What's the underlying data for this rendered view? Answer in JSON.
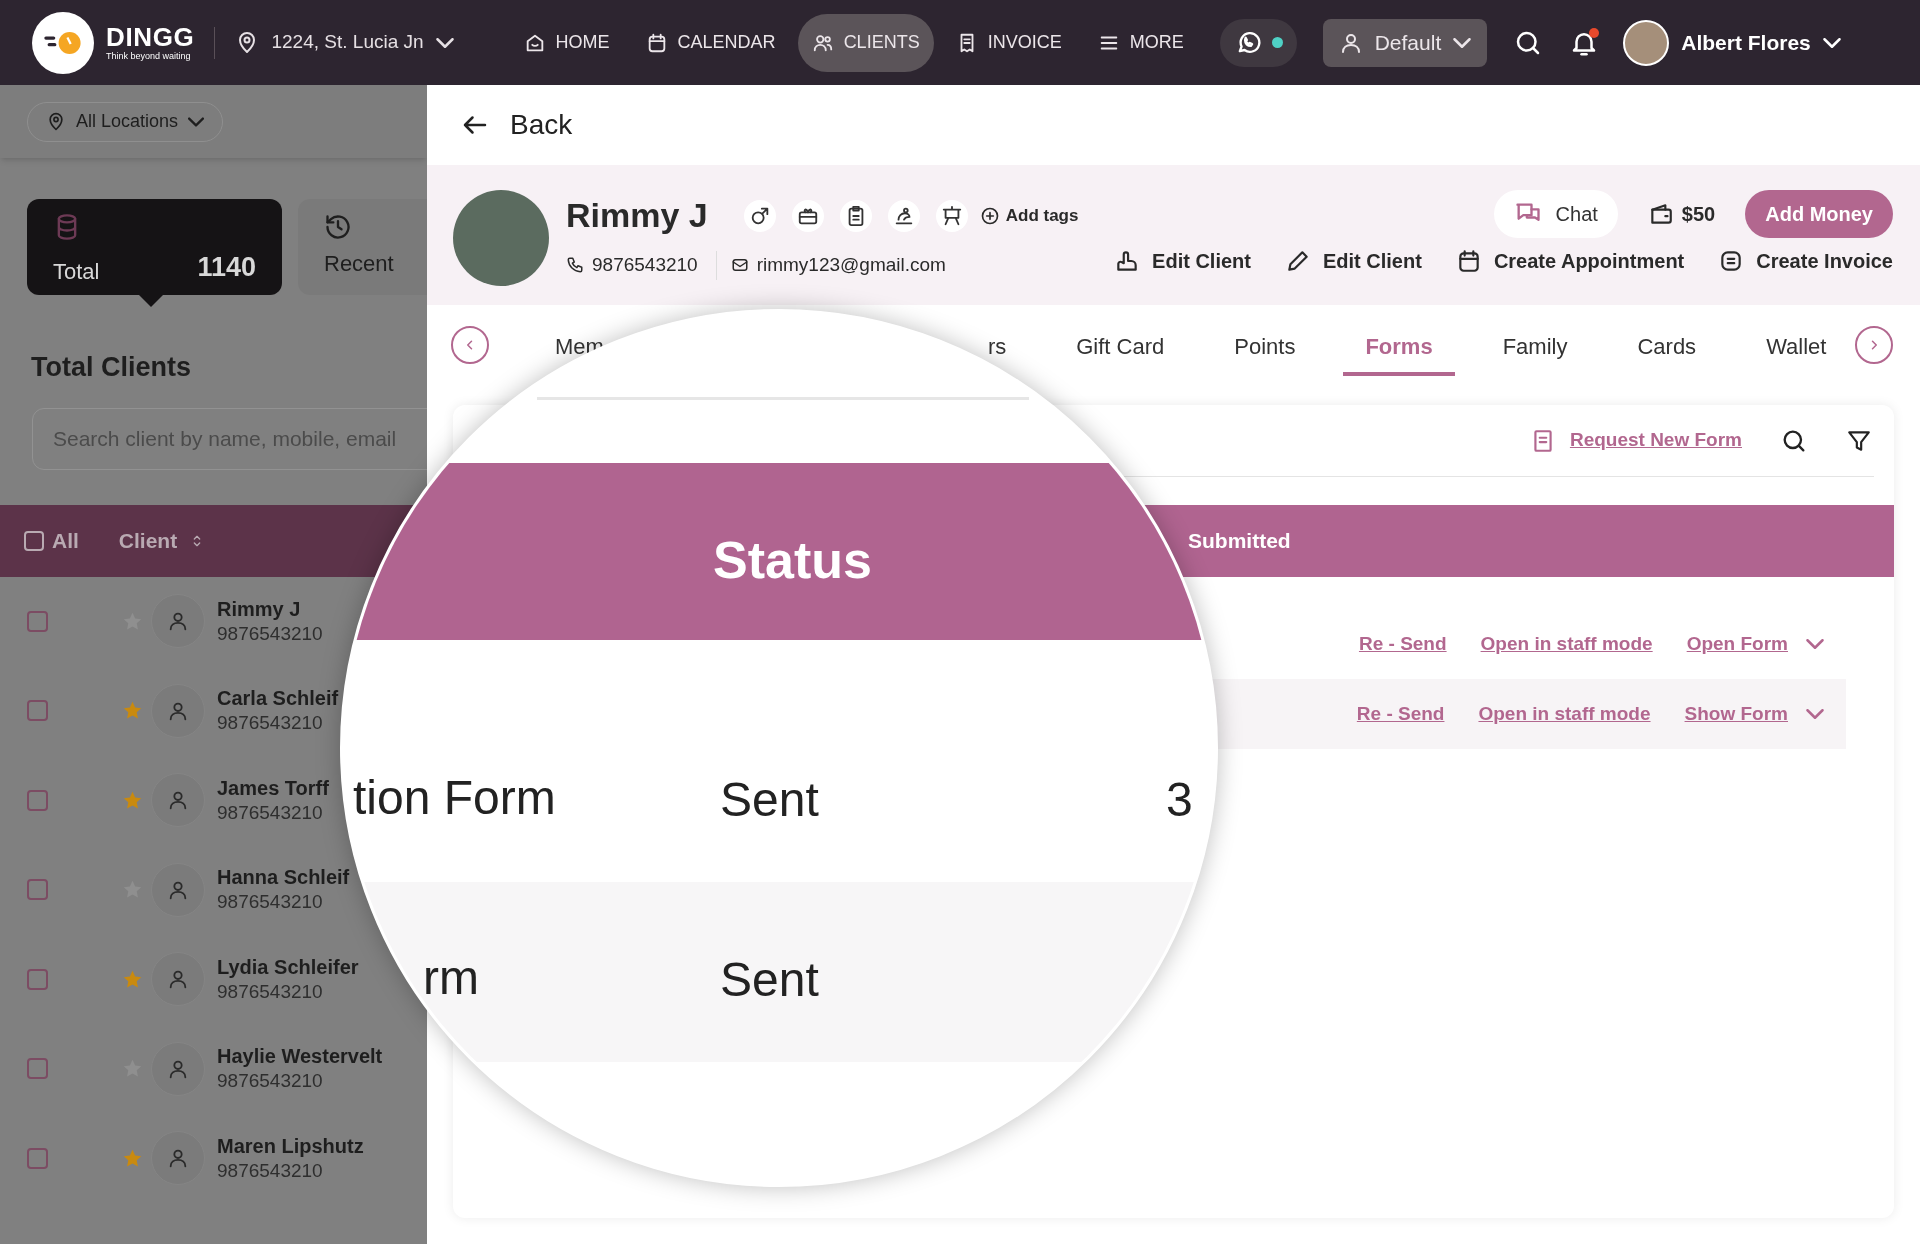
{
  "top_bar": {
    "logo": {
      "name": "DINGG",
      "tagline": "Think beyond waiting"
    },
    "location": "1224, St. Lucia Jn",
    "nav": [
      {
        "label": "HOME",
        "selected": false
      },
      {
        "label": "CALENDAR",
        "selected": false
      },
      {
        "label": "CLIENTS",
        "selected": true
      },
      {
        "label": "INVOICE",
        "selected": false
      },
      {
        "label": "MORE",
        "selected": false
      }
    ],
    "whatsapp": {
      "online": true
    },
    "profile": "Default",
    "notifications": {
      "unread": true
    },
    "user": "Albert Flores"
  },
  "left_panel": {
    "location_filter": "All Locations",
    "stats": [
      {
        "label": "Total",
        "count": "1140",
        "selected": true
      },
      {
        "label": "Recent",
        "selected": false
      }
    ],
    "title": "Total Clients",
    "search": {
      "placeholder": "Search client by name, mobile, email"
    },
    "table_header": {
      "all": "All",
      "all_checked": false,
      "client": "Client"
    },
    "rows": [
      {
        "name": "Rimmy J",
        "phone": "9876543210",
        "starred": false,
        "checked": false
      },
      {
        "name": "Carla Schleif",
        "phone": "9876543210",
        "starred": true,
        "checked": false
      },
      {
        "name": "James Torff",
        "phone": "9876543210",
        "starred": true,
        "checked": false
      },
      {
        "name": "Hanna Schleif",
        "phone": "9876543210",
        "starred": false,
        "checked": false
      },
      {
        "name": "Lydia Schleifer",
        "phone": "9876543210",
        "starred": true,
        "checked": false
      },
      {
        "name": "Haylie Westervelt",
        "phone": "9876543210",
        "starred": false,
        "checked": false
      },
      {
        "name": "Maren Lipshutz",
        "phone": "9876543210",
        "starred": true,
        "checked": false
      }
    ]
  },
  "client_detail": {
    "back": "Back",
    "name": "Rimmy J",
    "phone": "9876543210",
    "email": "rimmy123@gmail.com",
    "add_tags": "Add tags",
    "chat": "Chat",
    "wallet": "$50",
    "add_money": "Add Money",
    "actions": [
      "Edit Client",
      "Edit Client",
      "Create Appointment",
      "Create Invoice"
    ],
    "tabs": [
      {
        "label": "Mem",
        "selected": false
      },
      {
        "label": "rs",
        "selected": false
      },
      {
        "label": "Gift Card",
        "selected": false
      },
      {
        "label": "Points",
        "selected": false
      },
      {
        "label": "Forms",
        "selected": true
      },
      {
        "label": "Family",
        "selected": false
      },
      {
        "label": "Cards",
        "selected": false
      },
      {
        "label": "Wallet",
        "selected": false
      }
    ],
    "forms": {
      "request": "Request New Form",
      "header_submitted": "Submitted",
      "rows": [
        {
          "actions": [
            "Re - Send",
            "Open in staff mode",
            "Open Form"
          ]
        },
        {
          "actions": [
            "Re - Send",
            "Open in staff mode",
            "Show Form"
          ]
        }
      ]
    }
  },
  "magnifier": {
    "header": "Status",
    "rows": [
      {
        "column_1": "tion Form",
        "status": "Sent",
        "column_3": "3"
      },
      {
        "column_1": "rm",
        "status": "Sent"
      }
    ]
  }
}
